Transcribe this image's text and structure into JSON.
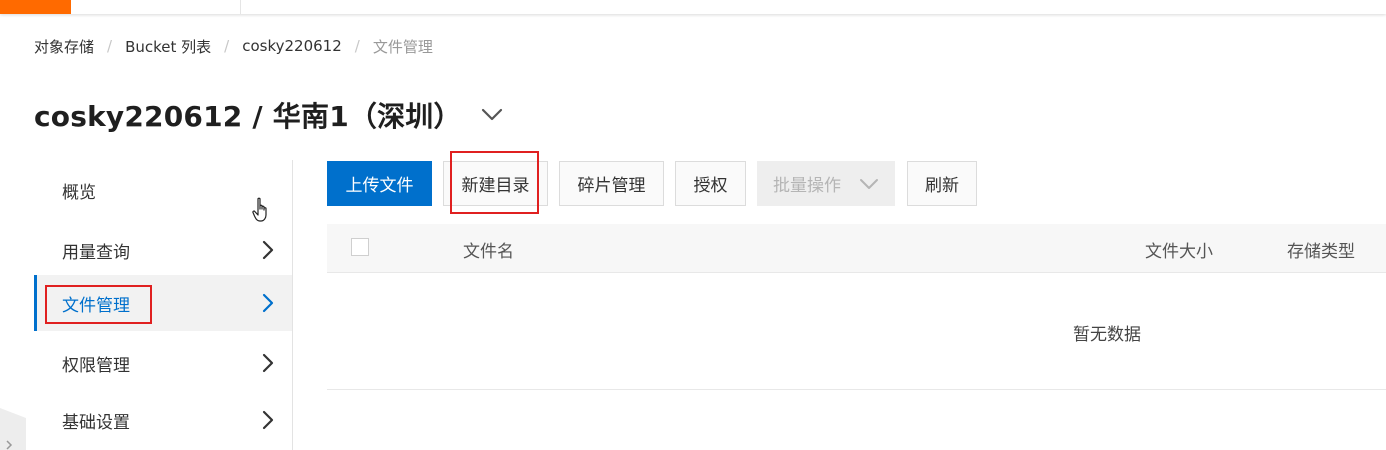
{
  "colors": {
    "brand": "#ff6a00",
    "primary": "#0070cc",
    "highlight_box": "#e02020"
  },
  "breadcrumb": {
    "items": [
      "对象存储",
      "Bucket 列表",
      "cosky220612",
      "文件管理"
    ],
    "separator": "/"
  },
  "header": {
    "title": "cosky220612 / 华南1（深圳）",
    "dropdown_icon": "chevron-down-icon"
  },
  "sidebar": {
    "items": [
      {
        "label": "概览",
        "has_arrow": false,
        "active": false
      },
      {
        "label": "用量查询",
        "has_arrow": true,
        "active": false
      },
      {
        "label": "文件管理",
        "has_arrow": true,
        "active": true
      },
      {
        "label": "权限管理",
        "has_arrow": true,
        "active": false
      },
      {
        "label": "基础设置",
        "has_arrow": true,
        "active": false
      }
    ]
  },
  "toolbar": {
    "upload_label": "上传文件",
    "new_dir_label": "新建目录",
    "fragment_label": "碎片管理",
    "authorize_label": "授权",
    "batch_label": "批量操作",
    "refresh_label": "刷新"
  },
  "table": {
    "columns": [
      "文件名",
      "文件大小",
      "存储类型"
    ],
    "empty_text": "暂无数据"
  }
}
